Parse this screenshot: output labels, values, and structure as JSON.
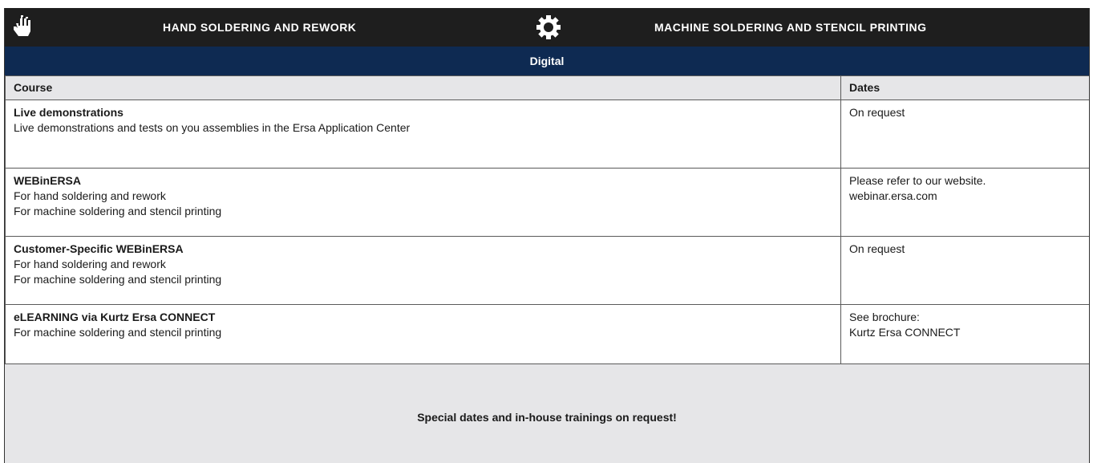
{
  "header": {
    "hand": {
      "icon": "hand-icon",
      "title": "HAND SOLDERING AND REWORK"
    },
    "machine": {
      "icon": "gear-icon",
      "title": "MACHINE SOLDERING AND STENCIL PRINTING"
    }
  },
  "section": {
    "title": "Digital"
  },
  "table": {
    "columns": {
      "course": "Course",
      "dates": "Dates"
    },
    "rows": [
      {
        "title": "Live demonstrations",
        "lines": [
          "Live demonstrations and tests on you assemblies in the Ersa Application Center",
          ""
        ],
        "dates": [
          "On request",
          ""
        ]
      },
      {
        "title": "WEBinERSA",
        "lines": [
          "For hand soldering and rework",
          "For machine soldering and stencil printing"
        ],
        "dates": [
          "Please refer to our website.",
          "webinar.ersa.com"
        ]
      },
      {
        "title": "Customer-Specific WEBinERSA",
        "lines": [
          "For hand soldering and rework",
          "For machine soldering and stencil printing"
        ],
        "dates": [
          "On request",
          ""
        ]
      },
      {
        "title": "eLEARNING via Kurtz Ersa CONNECT",
        "lines": [
          "For machine soldering and stencil printing",
          ""
        ],
        "dates": [
          "See brochure:",
          "Kurtz Ersa CONNECT"
        ]
      }
    ]
  },
  "footer": {
    "note": "Special dates and in-house trainings on request!"
  }
}
